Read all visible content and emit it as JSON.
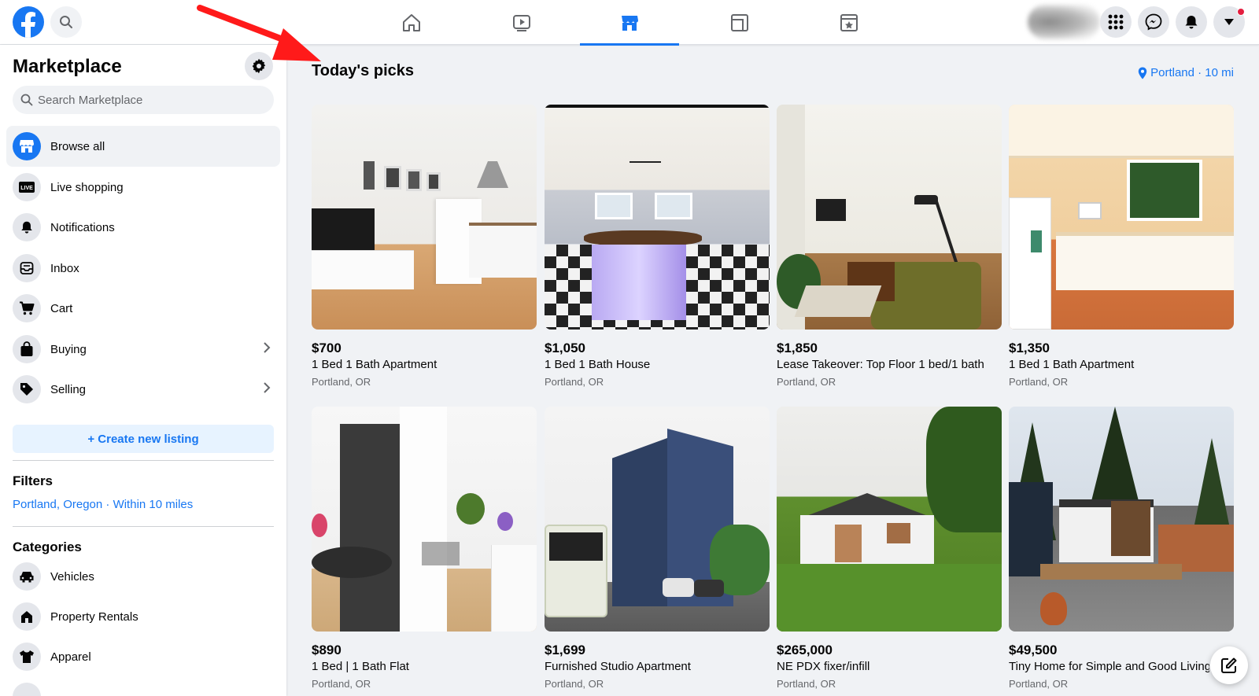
{
  "nav": {
    "tabs": [
      {
        "name": "home",
        "active": false
      },
      {
        "name": "watch",
        "active": false
      },
      {
        "name": "marketplace",
        "active": true
      },
      {
        "name": "groups",
        "active": false
      },
      {
        "name": "gaming",
        "active": false
      }
    ],
    "icons": [
      "facebook-logo",
      "search-icon",
      "home-icon",
      "watch-icon",
      "marketplace-icon",
      "groups-icon",
      "gaming-icon",
      "menu-grid-icon",
      "messenger-icon",
      "bell-icon",
      "caret-down-icon"
    ],
    "accent_color": "#1877f2"
  },
  "sidebar": {
    "title": "Marketplace",
    "search_placeholder": "Search Marketplace",
    "items": [
      {
        "label": "Browse all",
        "icon": "storefront-icon",
        "active": true
      },
      {
        "label": "Live shopping",
        "icon": "live-icon",
        "active": false
      },
      {
        "label": "Notifications",
        "icon": "bell-icon",
        "active": false
      },
      {
        "label": "Inbox",
        "icon": "inbox-icon",
        "active": false
      },
      {
        "label": "Cart",
        "icon": "cart-icon",
        "active": false
      },
      {
        "label": "Buying",
        "icon": "shopping-bag-icon",
        "active": false
      },
      {
        "label": "Selling",
        "icon": "tag-icon",
        "active": false
      }
    ],
    "create_label": "+ Create new listing",
    "filters_heading": "Filters",
    "filters_value": "Portland, Oregon · Within 10 miles",
    "categories_heading": "Categories",
    "categories": [
      {
        "label": "Vehicles",
        "icon": "car-icon"
      },
      {
        "label": "Property Rentals",
        "icon": "house-icon"
      },
      {
        "label": "Apparel",
        "icon": "shirt-icon"
      }
    ]
  },
  "main": {
    "title": "Today's picks",
    "location": "Portland · 10 mi",
    "listings": [
      {
        "price": "$700",
        "title": "1 Bed 1 Bath Apartment",
        "location": "Portland, OR"
      },
      {
        "price": "$1,050",
        "title": "1 Bed 1 Bath House",
        "location": "Portland, OR"
      },
      {
        "price": "$1,850",
        "title": "Lease Takeover: Top Floor 1 bed/1 bath",
        "location": "Portland, OR"
      },
      {
        "price": "$1,350",
        "title": "1 Bed 1 Bath Apartment",
        "location": "Portland, OR"
      },
      {
        "price": "$890",
        "title": "1 Bed | 1 Bath Flat",
        "location": "Portland, OR"
      },
      {
        "price": "$1,699",
        "title": "Furnished Studio Apartment",
        "location": "Portland, OR"
      },
      {
        "price": "$265,000",
        "title": "NE PDX fixer/infill",
        "location": "Portland, OR"
      },
      {
        "price": "$49,500",
        "title": "Tiny Home for Simple and Good Living",
        "location": "Portland, OR"
      }
    ]
  }
}
